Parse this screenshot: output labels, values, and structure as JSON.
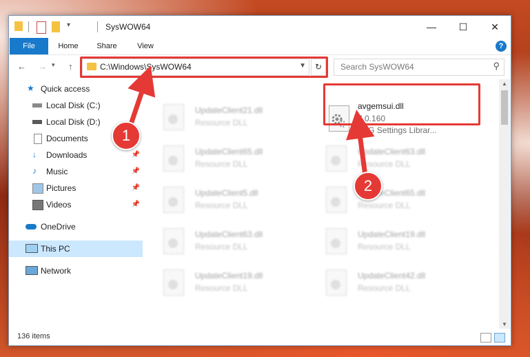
{
  "window": {
    "title": "SysWOW64"
  },
  "ribbon": {
    "tabs": [
      "File",
      "Home",
      "Share",
      "View"
    ],
    "help": "?"
  },
  "address": {
    "path": "C:\\Windows\\SysWOW64",
    "search_placeholder": "Search SysWOW64"
  },
  "sidebar": {
    "items": [
      {
        "label": "Quick access",
        "icon": "star-icon",
        "pinned": false
      },
      {
        "label": "Local Disk (C:)",
        "icon": "drive-icon",
        "pinned": false
      },
      {
        "label": "Local Disk (D:)",
        "icon": "drive-icon",
        "pinned": false
      },
      {
        "label": "Documents",
        "icon": "documents-icon",
        "pinned": true
      },
      {
        "label": "Downloads",
        "icon": "download-icon",
        "pinned": true
      },
      {
        "label": "Music",
        "icon": "music-icon",
        "pinned": true
      },
      {
        "label": "Pictures",
        "icon": "pictures-icon",
        "pinned": true
      },
      {
        "label": "Videos",
        "icon": "videos-icon",
        "pinned": true
      },
      {
        "label": "OneDrive",
        "icon": "cloud-icon",
        "pinned": false
      },
      {
        "label": "This PC",
        "icon": "computer-icon",
        "pinned": false,
        "selected": true
      },
      {
        "label": "Network",
        "icon": "network-icon",
        "pinned": false
      }
    ]
  },
  "files": {
    "highlighted": {
      "name": "avgemsui.dll",
      "version": "7.0.160",
      "description": "AVG Settings Librar..."
    },
    "left_column": [
      {
        "name": "UpdateClient21.dll",
        "type": "Resource DLL"
      },
      {
        "name": "UpdateClient65.dll",
        "type": "Resource DLL"
      },
      {
        "name": "UpdateClient5.dll",
        "type": "Resource DLL"
      },
      {
        "name": "UpdateClient63.dll",
        "type": "Resource DLL"
      },
      {
        "name": "UpdateClient19.dll",
        "type": "Resource DLL"
      }
    ],
    "right_column": [
      {
        "name": "UpdateClient63.dll",
        "type": "Resource DLL"
      },
      {
        "name": "UpdateClient65.dll",
        "type": "Resource DLL"
      },
      {
        "name": "UpdateClient19.dll",
        "type": "Resource DLL"
      },
      {
        "name": "UpdateClient42.dll",
        "type": "Resource DLL"
      }
    ]
  },
  "status": {
    "item_count": "136 items"
  },
  "callouts": [
    "1",
    "2"
  ],
  "colors": {
    "accent": "#1979ca",
    "highlight": "#e53935",
    "selection": "#cce8ff"
  }
}
